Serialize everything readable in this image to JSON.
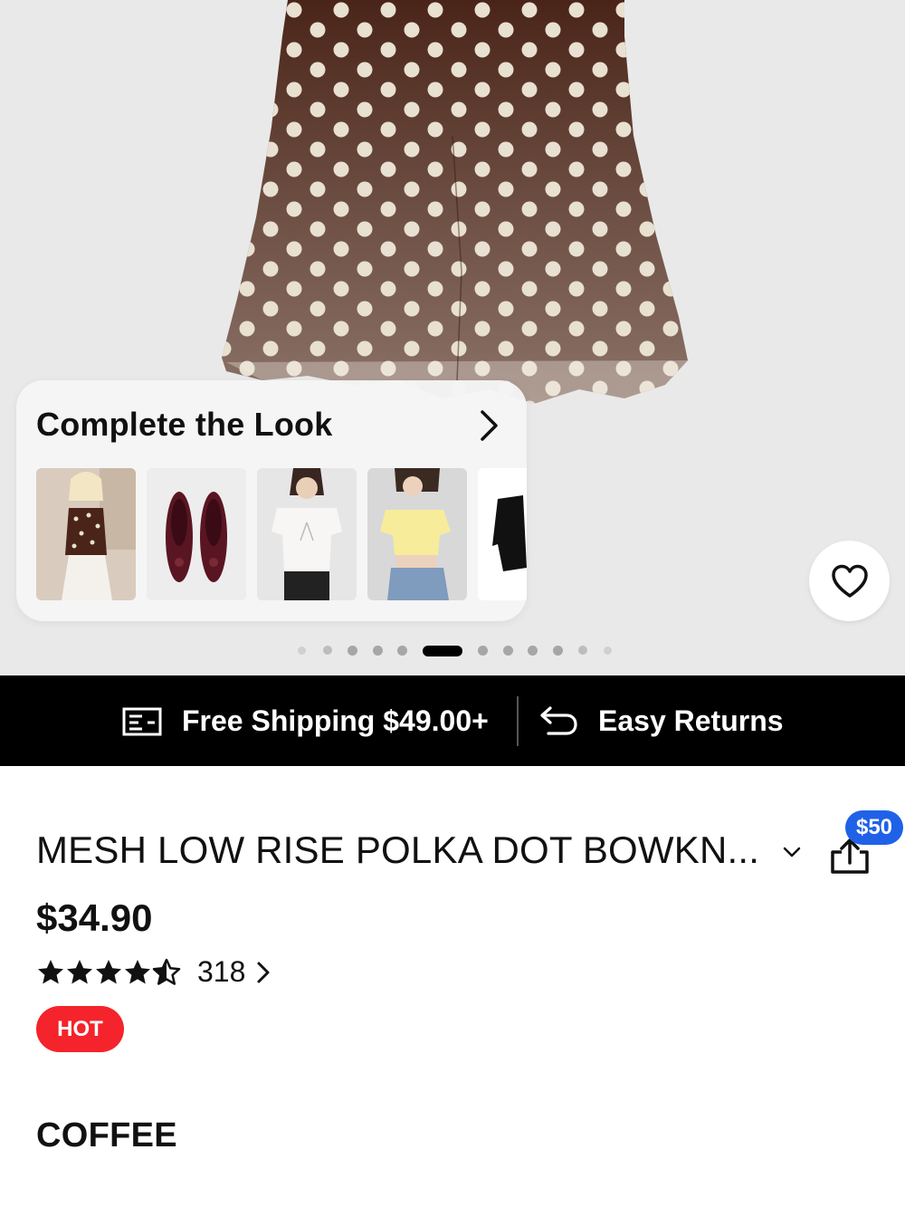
{
  "gallery": {
    "complete_the_look": {
      "title": "Complete the Look",
      "items": [
        "polka-dot-top-outfit",
        "burgundy-ballet-flats",
        "white-tie-front-blouse",
        "yellow-crop-top",
        "black-top"
      ]
    },
    "slide_count": 13,
    "active_slide": 6
  },
  "banner": {
    "shipping": "Free Shipping $49.00+",
    "returns": "Easy Returns"
  },
  "product": {
    "title": "MESH LOW RISE POLKA DOT BOWKN...",
    "price": "$34.90",
    "rating": 4.5,
    "review_count": "318",
    "badge": "HOT",
    "color": "COFFEE",
    "coupon": "$50"
  },
  "colors": {
    "skirt": "#4a2418",
    "dot": "#e8e0d0",
    "hot_badge": "#f5232b",
    "coupon_badge": "#1f62e8",
    "banner": "#000000"
  },
  "icons": [
    "chevron-right-icon",
    "heart-icon",
    "shipping-icon",
    "return-icon",
    "chevron-down-icon",
    "share-icon",
    "star-icon"
  ]
}
